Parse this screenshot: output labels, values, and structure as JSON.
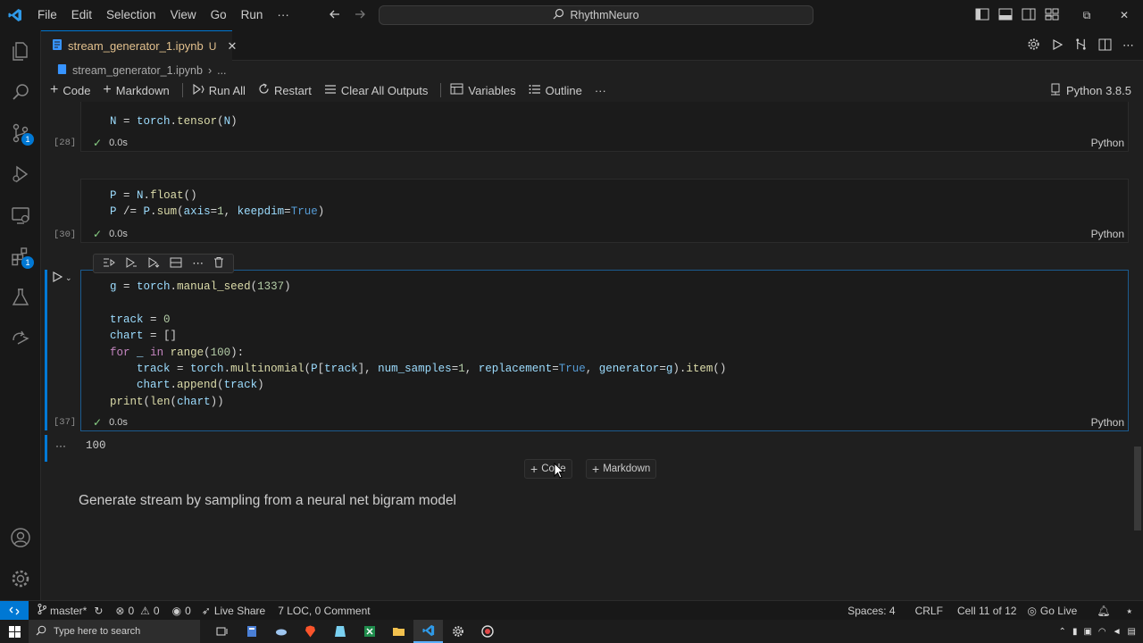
{
  "menu": [
    "File",
    "Edit",
    "Selection",
    "View",
    "Go",
    "Run",
    "···"
  ],
  "command_center": "RhythmNeuro",
  "tab": {
    "filename": "stream_generator_1.ipynb",
    "status": "U"
  },
  "breadcrumb": {
    "file": "stream_generator_1.ipynb",
    "more": "..."
  },
  "activity_badges": {
    "source_control": "1",
    "extensions": "1"
  },
  "toolbar": {
    "code": "Code",
    "markdown": "Markdown",
    "run_all": "Run All",
    "restart": "Restart",
    "clear_outputs": "Clear All Outputs",
    "variables": "Variables",
    "outline": "Outline",
    "more": "···",
    "kernel": "Python 3.8.5"
  },
  "cells": [
    {
      "exec": "[28]",
      "time": "0.0s",
      "lang": "Python"
    },
    {
      "exec": "[30]",
      "time": "0.0s",
      "lang": "Python"
    },
    {
      "exec": "[37]",
      "time": "0.0s",
      "lang": "Python"
    }
  ],
  "output": {
    "more": "···",
    "text": "100"
  },
  "add_cell": {
    "code": "Code",
    "markdown": "Markdown"
  },
  "markdown_text": "Generate stream by sampling from a neural net bigram model",
  "statusbar": {
    "branch": "master*",
    "errors": "0",
    "warnings": "0",
    "ports": "0",
    "live_share": "Live Share",
    "loc": "7 LOC, 0 Comment",
    "spaces": "Spaces: 4",
    "eol": "CRLF",
    "cell_pos": "Cell 11 of 12",
    "go_live": "Go Live"
  },
  "taskbar": {
    "search_placeholder": "Type here to search"
  },
  "colors": {
    "accent": "#0078d4",
    "check": "#89d185",
    "modified": "#e2c08d"
  }
}
